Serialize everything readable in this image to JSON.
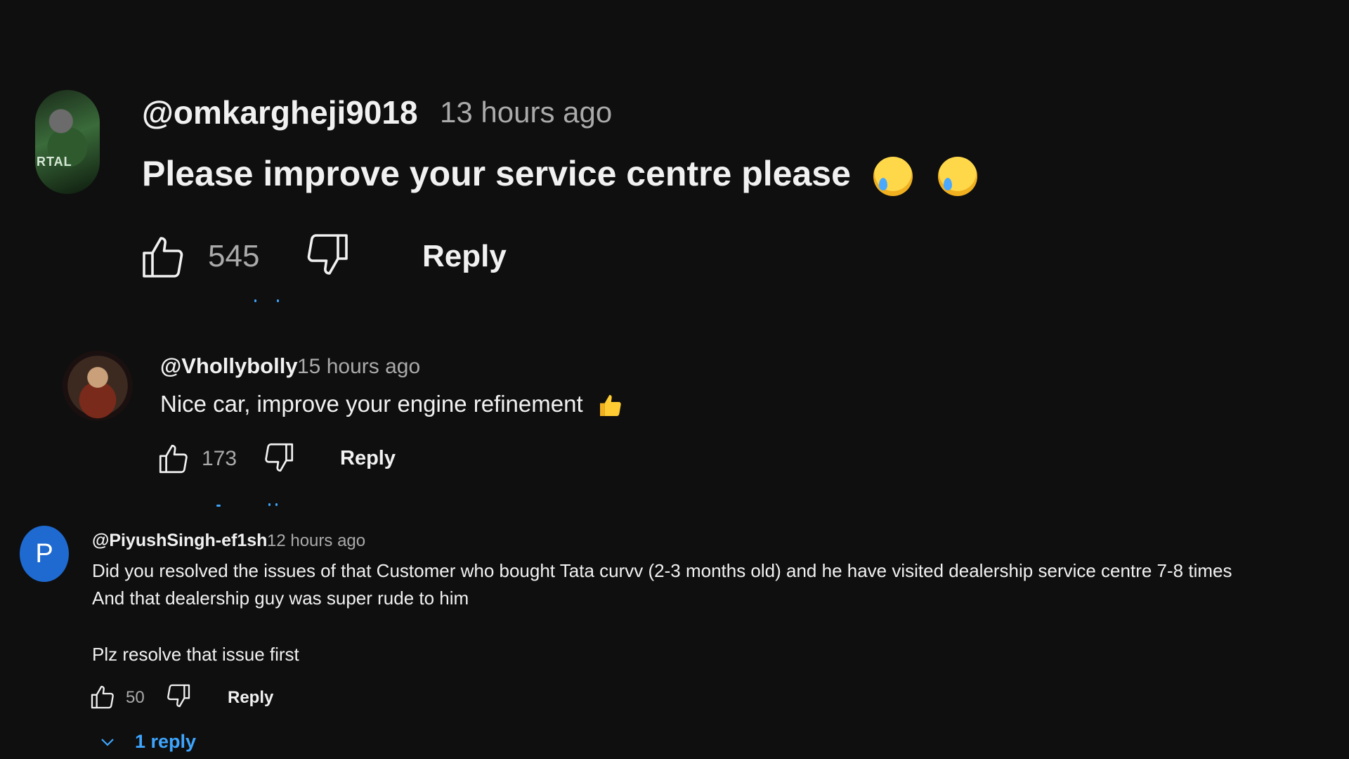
{
  "comments": [
    {
      "author": "@omkargheji9018",
      "time": "13 hours ago",
      "text": "Please improve your service centre please",
      "likes": "545",
      "reply_label": "Reply",
      "avatar_text": "RTAL"
    },
    {
      "author": "@Vhollybolly",
      "time": "15 hours ago",
      "text": "Nice car, improve your engine refinement",
      "likes": "173",
      "reply_label": "Reply"
    },
    {
      "author": "@PiyushSingh-ef1sh",
      "time": "12 hours ago",
      "text_line1": "Did you resolved the issues of that Customer who bought Tata curvv (2-3 months old) and he have visited dealership service centre 7-8 times",
      "text_line2": "And that dealership guy was super rude to him",
      "text_line3": "Plz resolve that issue first",
      "likes": "50",
      "reply_label": "Reply",
      "avatar_letter": "P",
      "replies_label": "1 reply"
    }
  ],
  "colors": {
    "background": "#0f0f0f",
    "text": "#f1f1f1",
    "muted": "#aaaaaa",
    "link": "#3ea6ff"
  }
}
